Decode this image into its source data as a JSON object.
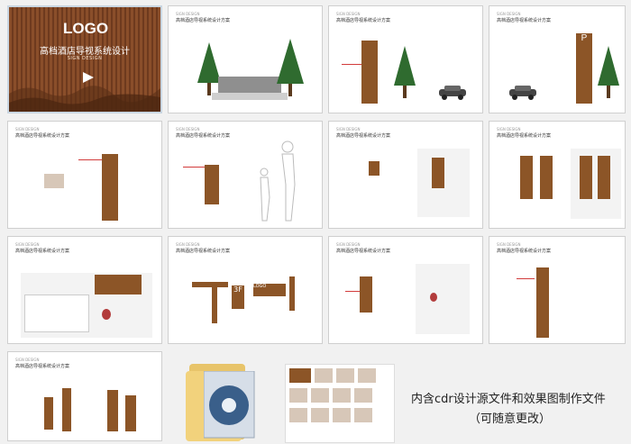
{
  "cover": {
    "logo": "LOGO",
    "title": "高档酒店导视系统设计",
    "subtitle": "SIGN DESIGN"
  },
  "thumb_header_small": "SIGN DESIGN",
  "thumb_header": "高档酒店导视系统设计方案",
  "pages": [
    {
      "id": "p1"
    },
    {
      "id": "p2"
    },
    {
      "id": "p3"
    },
    {
      "id": "p4"
    },
    {
      "id": "p5"
    },
    {
      "id": "p6"
    },
    {
      "id": "p7"
    },
    {
      "id": "p8"
    },
    {
      "id": "p9"
    },
    {
      "id": "p10"
    },
    {
      "id": "p11"
    },
    {
      "id": "p12"
    }
  ],
  "sign_labels": {
    "parking": "P",
    "floor": "3F",
    "logo_small": "LOGO"
  },
  "caption": {
    "line1": "内含cdr设计源文件和效果图制作文件",
    "line2": "（可随意更改）"
  },
  "colors": {
    "wood": "#8c5527",
    "wood_dark": "#6b3f1e",
    "annotation": "#d23b3b",
    "tree": "#2f6b2f"
  },
  "icons": [
    "folder-icon",
    "cd-disc-icon",
    "arrow-right-icon",
    "car-icon",
    "tree-icon",
    "person-silhouette-icon",
    "toilet-male-icon",
    "toilet-female-icon"
  ]
}
